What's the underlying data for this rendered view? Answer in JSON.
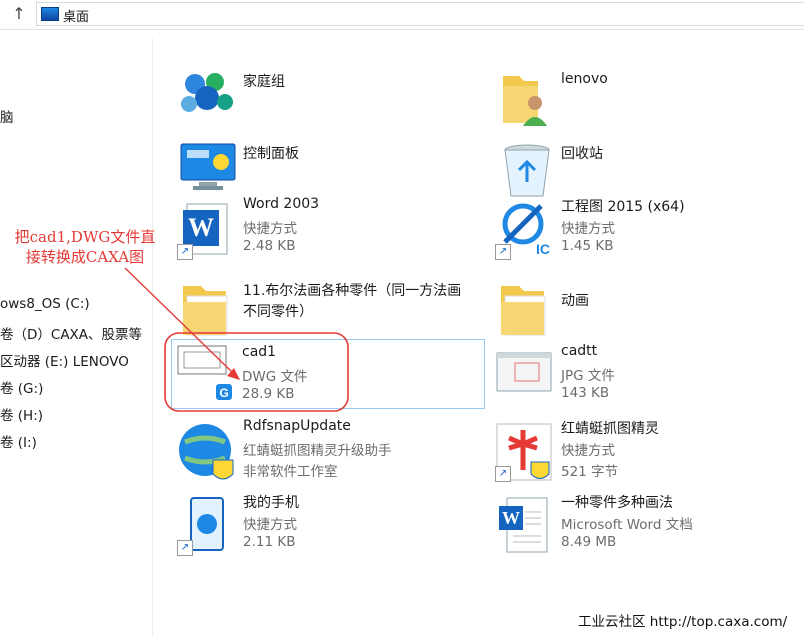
{
  "address": {
    "location": "桌面"
  },
  "nav": [
    {
      "label": "脑"
    },
    {
      "label": "ows8_OS (C:)"
    },
    {
      "label": "卷（D）CAXA、股票等"
    },
    {
      "label": "区动器 (E:) LENOVO"
    },
    {
      "label": "卷 (G:)"
    },
    {
      "label": "卷 (H:)"
    },
    {
      "label": "卷 (I:)"
    }
  ],
  "items": {
    "homegroup": {
      "name": "家庭组"
    },
    "lenovo": {
      "name": "lenovo"
    },
    "control_panel": {
      "name": "控制面板"
    },
    "recycle_bin": {
      "name": "回收站"
    },
    "word2003": {
      "name": "Word 2003",
      "type": "快捷方式",
      "size": "2.48 KB"
    },
    "gongchengtu": {
      "name": "工程图 2015 (x64)",
      "type": "快捷方式",
      "size": "1.45 KB"
    },
    "folder11": {
      "name": "11.布尔法画各种零件（同一方法画",
      "name2": "不同零件）"
    },
    "donghua": {
      "name": "动画"
    },
    "cad1": {
      "name": "cad1",
      "type": "DWG 文件",
      "size": "28.9 KB"
    },
    "cadtt": {
      "name": "cadtt",
      "type": "JPG 文件",
      "size": "143 KB"
    },
    "rdfsnap": {
      "name": "RdfsnapUpdate",
      "desc": "红蜻蜓抓图精灵升级助手",
      "company": "非常软件工作室"
    },
    "hongqingting": {
      "name": "红蜻蜓抓图精灵",
      "type": "快捷方式",
      "size": "521 字节"
    },
    "phone": {
      "name": "我的手机",
      "type": "快捷方式",
      "size": "2.11 KB"
    },
    "yizhong": {
      "name": "一种零件多种画法",
      "type": "Microsoft Word 文档",
      "size": "8.49 MB"
    }
  },
  "annotation": {
    "line1": "把cad1,DWG文件直",
    "line2": "接转换成CAXA图"
  },
  "watermark": "工业云社区 http://top.caxa.com/",
  "colors": {
    "annotation": "#e53935",
    "selection": "#99c9ef",
    "secondary_text": "#6d6d6d"
  }
}
